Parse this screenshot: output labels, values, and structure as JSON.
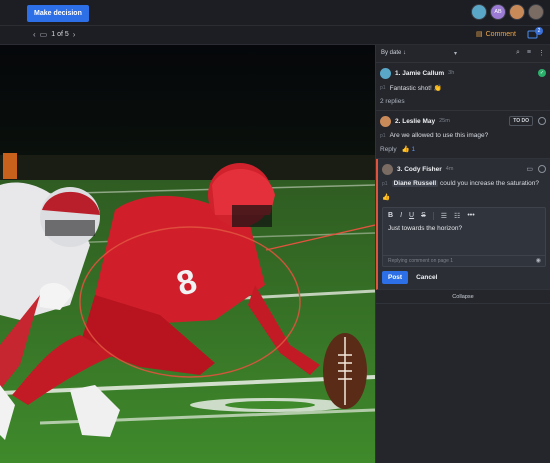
{
  "toolbar": {
    "make_decision_label": "Make decision"
  },
  "collaborators": [
    {
      "initials": "",
      "color": "#5aa6c7"
    },
    {
      "initials": "AB",
      "color": "#9b7bd4"
    },
    {
      "initials": "",
      "color": "#c98a5a"
    },
    {
      "initials": "",
      "color": "#7a6b63"
    }
  ],
  "nav": {
    "page_indicator": "1 of 5",
    "comment_label": "Comment",
    "notification_count": "2"
  },
  "panel": {
    "sort_label": "By date ↓",
    "collapse_label": "Collapse",
    "threads": [
      {
        "title": "1. Jamie Callum",
        "time": "3h",
        "page": "p1",
        "body": "Fantastic shot! 👏",
        "replies": "2 replies",
        "status": "resolved"
      },
      {
        "title": "2. Leslie May",
        "time": "25m",
        "page": "p1",
        "body": "Are we allowed to use this image?",
        "reply_label": "Reply",
        "like_count": "1",
        "status_label": "TO DO"
      },
      {
        "title": "3. Cody Fisher",
        "time": "4m",
        "page": "p1",
        "mention": "Diane Russell",
        "body": "could you increase the saturation?"
      }
    ],
    "editor": {
      "tools": [
        "B",
        "I",
        "U",
        "S",
        "☰",
        "☷",
        "•••"
      ],
      "text": "Just towards the horizon?",
      "placeholder": "Replying comment on page 1",
      "post_label": "Post",
      "cancel_label": "Cancel"
    }
  },
  "colors": {
    "accent": "#2d6fe6",
    "comment": "#f0a84a",
    "annotation": "#e0533e",
    "resolved": "#2bb06b"
  },
  "icons": [
    "chevron-left-icon",
    "page-icon",
    "chevron-right-icon",
    "comment-icon",
    "notification-icon",
    "search-icon",
    "filter-icon",
    "more-icon",
    "check-icon",
    "eye-icon"
  ]
}
